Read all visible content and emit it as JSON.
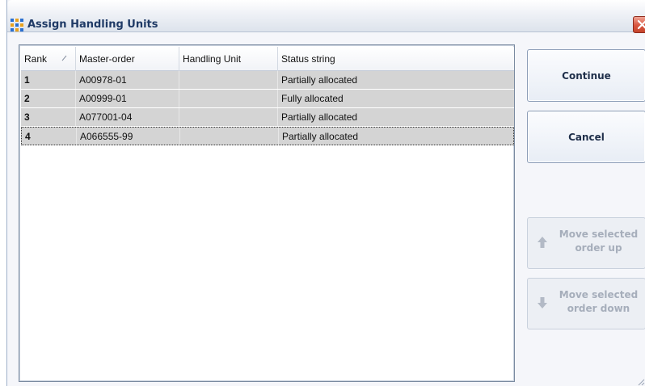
{
  "window": {
    "title": "Assign Handling Units"
  },
  "grid": {
    "columns": [
      "Rank",
      "Master-order",
      "Handling Unit",
      "Status string"
    ],
    "sort_indicator": "sort-ascending-icon",
    "rows": [
      {
        "rank": "1",
        "master_order": "A00978-01",
        "handling_unit": "",
        "status": "Partially allocated"
      },
      {
        "rank": "2",
        "master_order": "A00999-01",
        "handling_unit": "",
        "status": "Fully allocated"
      },
      {
        "rank": "3",
        "master_order": "A077001-04",
        "handling_unit": "",
        "status": "Partially allocated"
      },
      {
        "rank": "4",
        "master_order": "A066555-99",
        "handling_unit": "",
        "status": "Partially allocated"
      }
    ],
    "selected_row": 4
  },
  "buttons": {
    "continue_label": "Continue",
    "cancel_label": "Cancel",
    "move_up_label": "Move selected order up",
    "move_down_label": "Move selected order down"
  },
  "colors": {
    "title_text": "#1f3a66",
    "row_background": "#d4d4d4",
    "close_button": "#d8553f",
    "disabled_text": "#a6aebb"
  }
}
